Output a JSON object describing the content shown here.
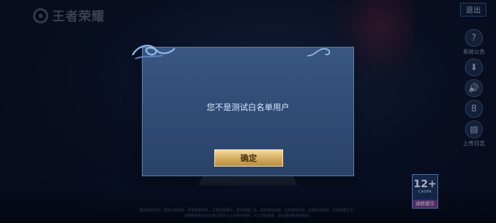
{
  "app": {
    "logo_text": "王者荣耀"
  },
  "top_right": {
    "exit_label": "退出"
  },
  "side_tools": [
    {
      "icon": "help-icon",
      "glyph": "?",
      "label": "系统公告"
    },
    {
      "icon": "download-icon",
      "glyph": "⬇",
      "label": ""
    },
    {
      "icon": "sound-icon",
      "glyph": "🔊",
      "label": ""
    },
    {
      "icon": "settings-icon",
      "glyph": "8",
      "label": ""
    },
    {
      "icon": "upload-log-icon",
      "glyph": "▤",
      "label": "上传日志"
    }
  ],
  "dialog": {
    "message": "您不是测试白名单用户",
    "confirm_label": "确定"
  },
  "age_rating": {
    "number": "12+",
    "sub": "CADPA",
    "tag": "适龄提示"
  },
  "fine_print": [
    "健康游戏忠告：抵制不良游戏，拒绝盗版游戏。注意自我保护，谨防受骗上当。适度游戏益脑，沉迷游戏伤身。合理安排时间，享受健康生活。",
    "本网络游戏适合年满12周岁以上的用户使用；为了您的健康，请合理控制游戏时间。"
  ],
  "colors": {
    "accent_gold": "#d9b46a",
    "dialog_bg": "#2f4a73"
  }
}
